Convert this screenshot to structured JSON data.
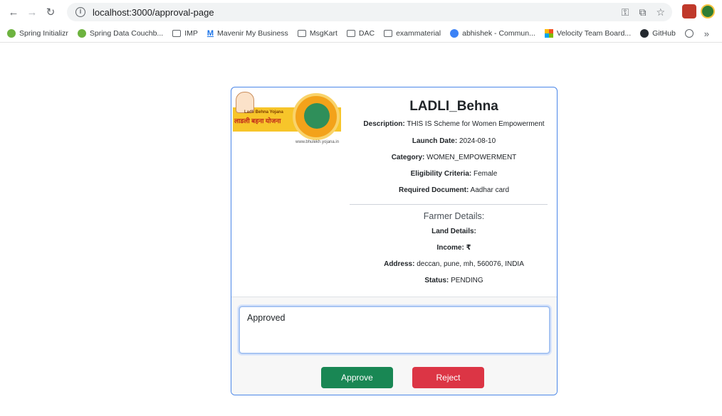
{
  "browser": {
    "url": "localhost:3000/approval-page",
    "bookmarks": [
      {
        "label": "Spring Initializr",
        "icon": "spring-icon"
      },
      {
        "label": "Spring Data Couchb...",
        "icon": "spring-icon"
      },
      {
        "label": "IMP",
        "icon": "folder-icon"
      },
      {
        "label": "Mavenir My Business",
        "icon": "mavenir-icon"
      },
      {
        "label": "MsgKart",
        "icon": "folder-icon"
      },
      {
        "label": "DAC",
        "icon": "folder-icon"
      },
      {
        "label": "exammaterial",
        "icon": "folder-icon"
      },
      {
        "label": "abhishek - Commun...",
        "icon": "community-icon"
      },
      {
        "label": "Velocity Team Board...",
        "icon": "velocity-icon"
      },
      {
        "label": "GitHub",
        "icon": "github-icon"
      }
    ],
    "more_label": "»"
  },
  "banner": {
    "yojana_text": "Ladli Behna Yojana",
    "hindi_text": "लाडली बहना योजना",
    "site_text": "www.bhulekh.yojana.in"
  },
  "scheme": {
    "title": "LADLI_Behna",
    "description_label": "Description:",
    "description_value": "THIS IS Scheme for Women Empowerment",
    "launch_label": "Launch Date:",
    "launch_value": "2024-08-10",
    "category_label": "Category:",
    "category_value": "WOMEN_EMPOWERMENT",
    "eligibility_label": "Eligibility Criteria:",
    "eligibility_value": "Female",
    "document_label": "Required Document:",
    "document_value": "Aadhar card"
  },
  "farmer": {
    "heading": "Farmer Details:",
    "land_label": "Land Details:",
    "income_label": "Income: ₹",
    "address_label": "Address:",
    "address_value": "deccan, pune, mh, 560076, INDIA",
    "status_label": "Status:",
    "status_value": "PENDING"
  },
  "actions": {
    "comment_value": "Approved",
    "approve_label": "Approve",
    "reject_label": "Reject"
  },
  "colors": {
    "approve": "#198754",
    "reject": "#dc3545",
    "card_border": "#4a86e8"
  }
}
